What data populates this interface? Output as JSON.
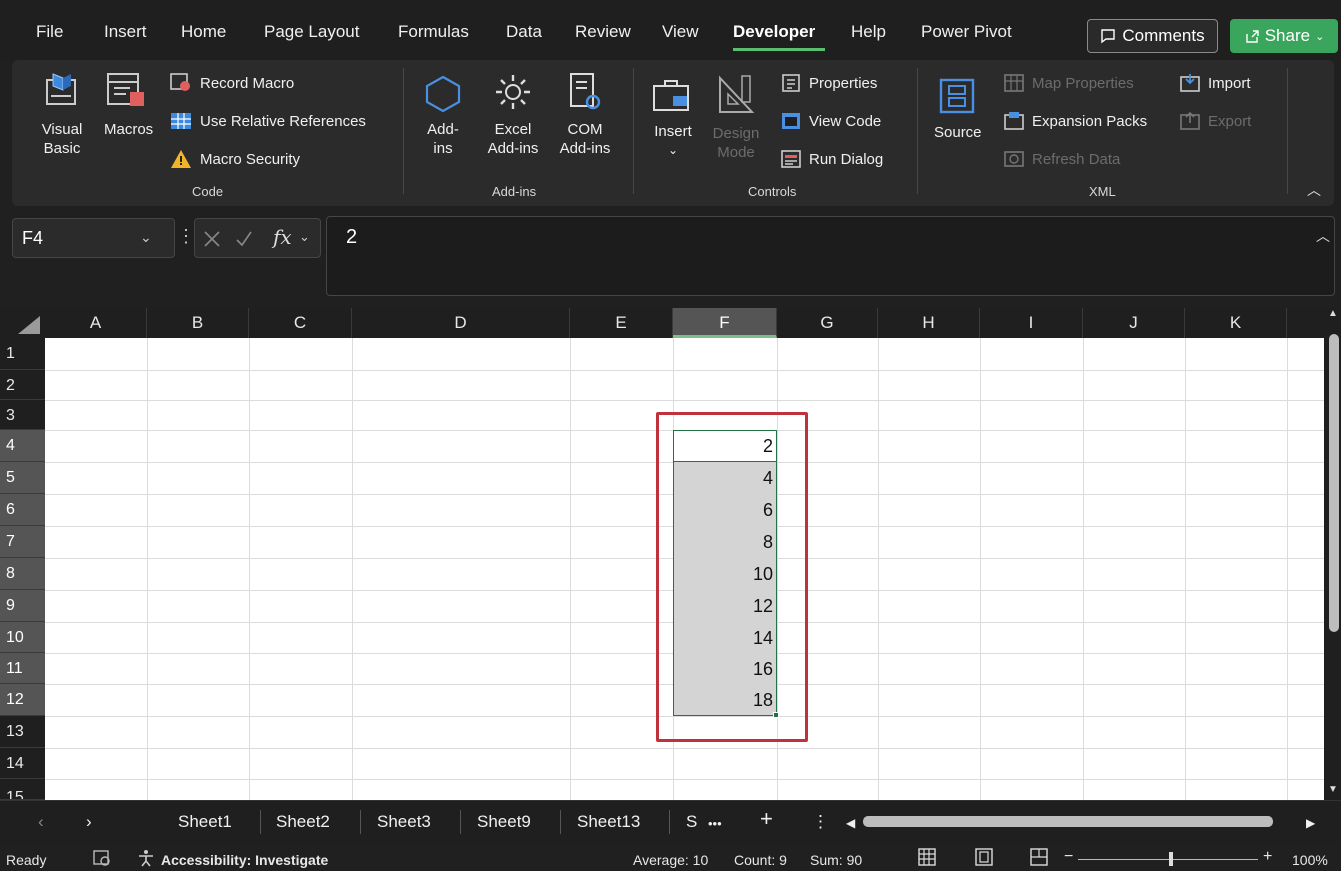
{
  "menu": {
    "tabs": [
      "File",
      "Insert",
      "Home",
      "Page Layout",
      "Formulas",
      "Data",
      "Review",
      "View",
      "Developer",
      "Help",
      "Power Pivot"
    ],
    "active_tab": "Developer",
    "comments_label": "Comments",
    "share_label": "Share"
  },
  "ribbon": {
    "code": {
      "visual_basic": "Visual Basic",
      "visual_basic_1": "Visual",
      "visual_basic_2": "Basic",
      "macros": "Macros",
      "record_macro": "Record Macro",
      "use_relative": "Use Relative References",
      "macro_security": "Macro Security",
      "group_label": "Code"
    },
    "addins": {
      "addins_1": "Add-",
      "addins_2": "ins",
      "excel_1": "Excel",
      "excel_2": "Add-ins",
      "com_1": "COM",
      "com_2": "Add-ins",
      "group_label": "Add-ins"
    },
    "controls": {
      "insert": "Insert",
      "design_1": "Design",
      "design_2": "Mode",
      "properties": "Properties",
      "view_code": "View Code",
      "run_dialog": "Run Dialog",
      "group_label": "Controls"
    },
    "xml": {
      "source": "Source",
      "map_properties": "Map Properties",
      "expansion_packs": "Expansion Packs",
      "refresh_data": "Refresh Data",
      "import": "Import",
      "export": "Export",
      "group_label": "XML"
    }
  },
  "formula_bar": {
    "name_box": "F4",
    "formula": "2",
    "fx_label": "fx"
  },
  "grid": {
    "columns": [
      "A",
      "B",
      "C",
      "D",
      "E",
      "F",
      "G",
      "H",
      "I",
      "J",
      "K"
    ],
    "selected_column": "F",
    "rows": [
      "1",
      "2",
      "3",
      "4",
      "5",
      "6",
      "7",
      "8",
      "9",
      "10",
      "11",
      "12",
      "13",
      "14",
      "15"
    ],
    "selected_rows": [
      "4",
      "5",
      "6",
      "7",
      "8",
      "9",
      "10",
      "11",
      "12"
    ],
    "column_f_values": [
      "2",
      "4",
      "6",
      "8",
      "10",
      "12",
      "14",
      "16",
      "18"
    ]
  },
  "sheets": {
    "tabs": [
      "Sheet1",
      "Sheet2",
      "Sheet3",
      "Sheet9",
      "Sheet13",
      "S"
    ],
    "more": "•••",
    "add": "+"
  },
  "status": {
    "ready": "Ready",
    "accessibility": "Accessibility: Investigate",
    "average": "Average: 10",
    "count": "Count: 9",
    "sum": "Sum: 90",
    "zoom": "100%"
  },
  "colors": {
    "accent_green": "#3aa55c",
    "selection_border": "#217346",
    "highlight_red": "#c0323b"
  }
}
